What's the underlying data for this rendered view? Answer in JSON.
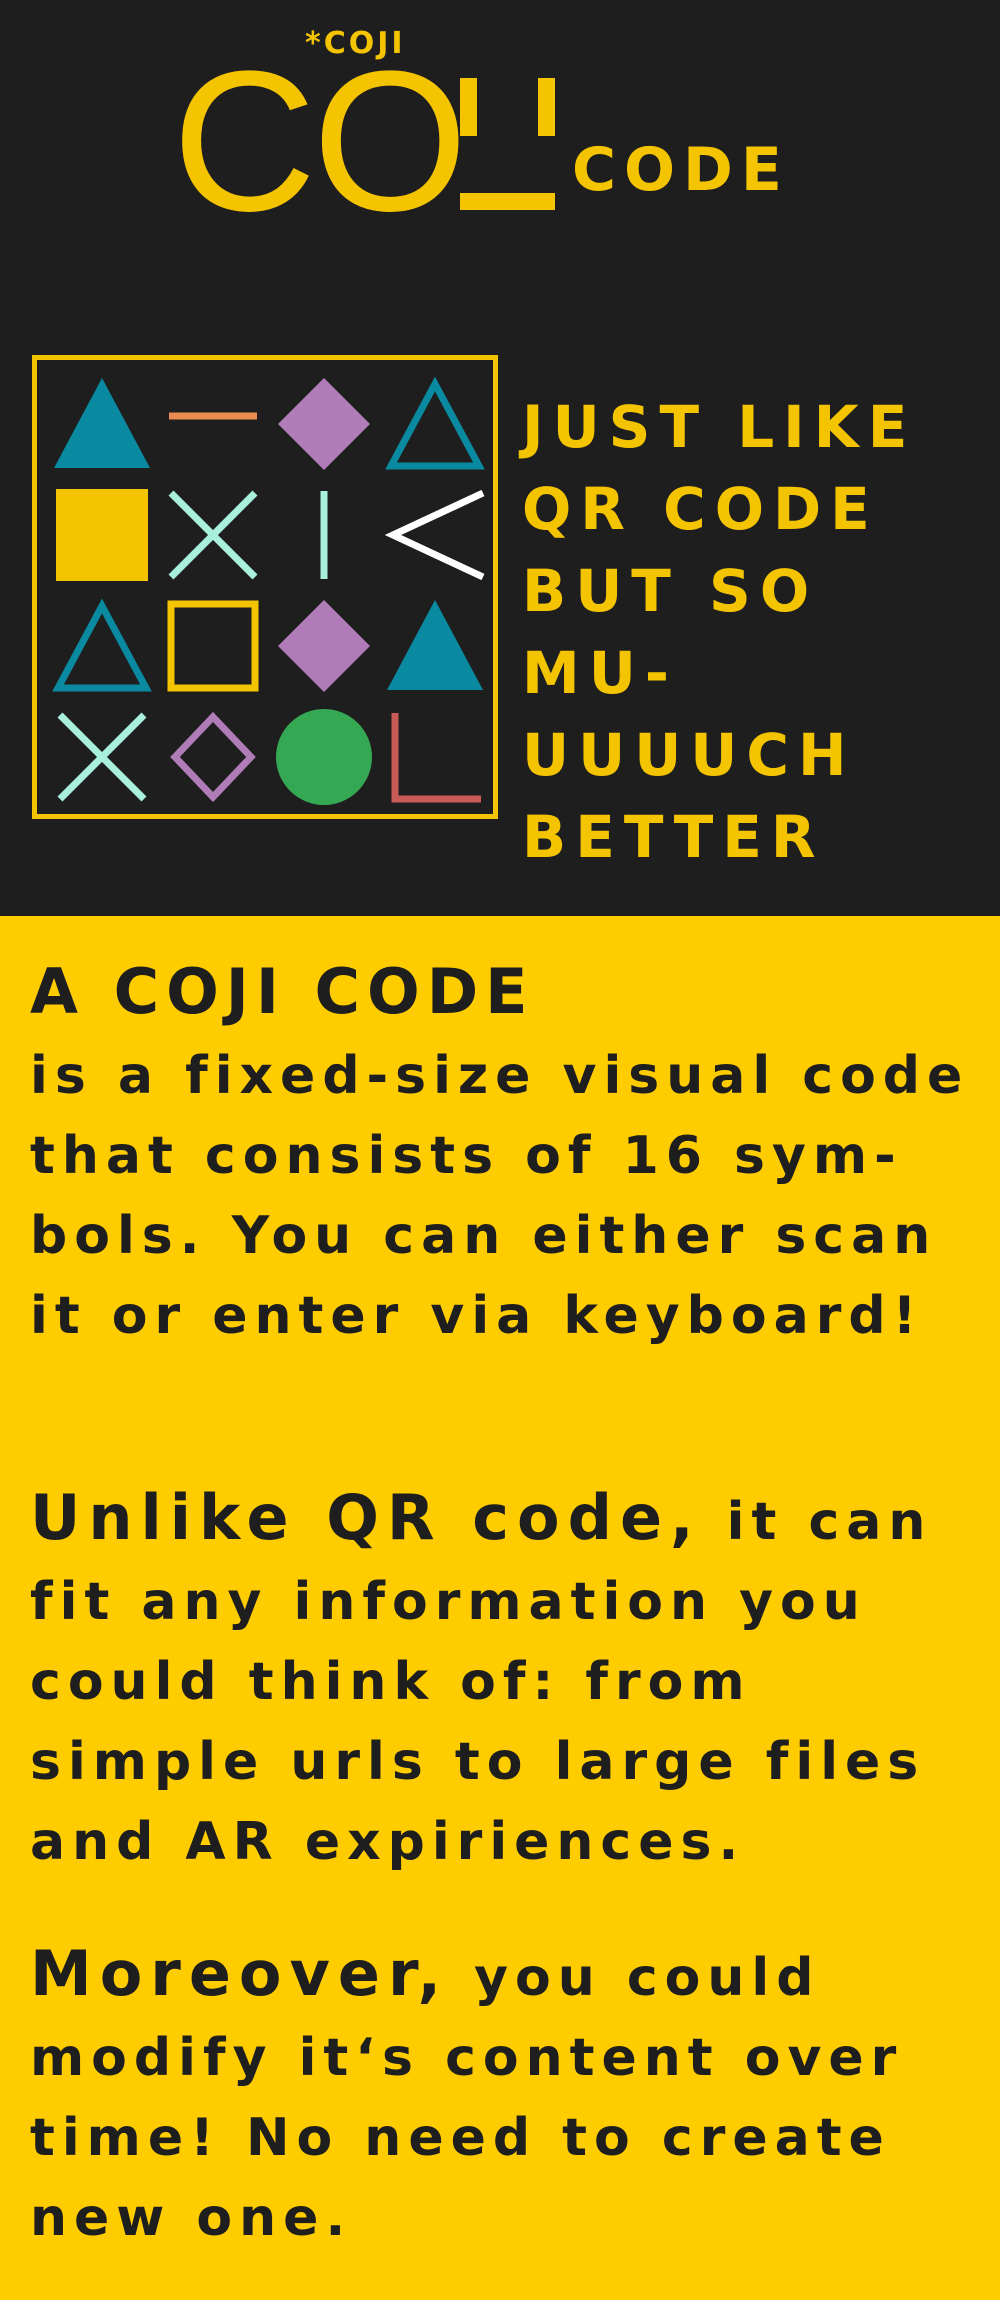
{
  "brand": {
    "tag": "*COJI",
    "main": "CO",
    "suffix": "CODE"
  },
  "code_grid": [
    [
      "triangle-filled",
      "dash",
      "diamond-filled",
      "triangle-outline"
    ],
    [
      "square-filled",
      "cross",
      "vertical-bar",
      "chevron-left"
    ],
    [
      "triangle-outline",
      "square-outline",
      "diamond-filled",
      "triangle-filled"
    ],
    [
      "cross",
      "diamond-outline",
      "circle-filled",
      "corner-l"
    ]
  ],
  "colors": {
    "dark": "#1e1e1e",
    "yellow": "#f5c400",
    "panel_yellow": "#ffcc00",
    "teal": "#0a8aa0",
    "orange": "#ec8b4f",
    "purple": "#b07cb8",
    "mint": "#a8f0dc",
    "green": "#34a853",
    "red": "#c95a58",
    "white": "#ffffff"
  },
  "tagline": [
    "JUST LIKE",
    "QR CODE",
    "BUT SO MU-",
    "UUUUCH",
    "BETTER"
  ],
  "info": {
    "heading": "A COJI CODE",
    "paragraph1": "is a fixed-size visual code that consists of 16 sym-bols. You can either scan it or enter via keyboard!",
    "paragraph2_lead": "Unlike QR code,",
    "paragraph2_rest": " it can fit any information you could think of: from simple urls to large files and AR expiriences.",
    "paragraph3_lead": "Moreover,",
    "paragraph3_rest": " you could modify it‘s content over time! No need to create new one."
  }
}
